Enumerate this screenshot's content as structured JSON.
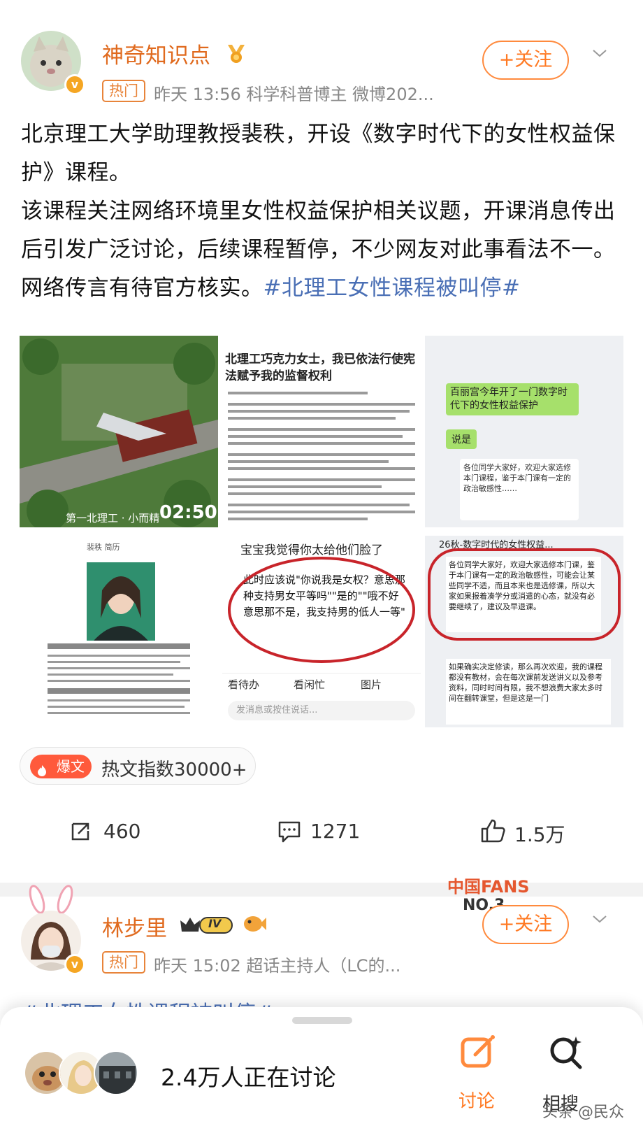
{
  "post1": {
    "username": "神奇知识点",
    "hot_tag": "热门",
    "meta": "昨天 13:56  科学科普博主 微博202...",
    "follow_label": "+关注",
    "paragraphs": [
      "北京理工大学助理教授裴秩，开设《数字时代下的女性权益保护》课程。",
      "该课程关注网络环境里女性权益保护相关议题，开课消息传出后引发广泛讨论，后续课程暂停，不少网友对此事看法不一。"
    ],
    "last_line_text": "网络传言有待官方核实。",
    "hashtag": "#北理工女性课程被叫停#",
    "images": {
      "video_caption": "第一北理工 · 小而精",
      "video_duration": "02:50",
      "doc_title": "北理工巧克力女士，我已依法行使宪法赋予我的监督权利",
      "chat_top_bubble1": "百丽宫今年开了一门数字时代下的女性权益保护",
      "chat_top_bubble2": "说是",
      "chat_top_msg": "各位同学大家好，欢迎大家选修本门课程，鉴于本门课有一定的政治敏感性……",
      "profile_name": "裴秩 简历",
      "chat_bottom_top": "宝宝我觉得你太给他们脸了",
      "chat_bottom_quote": "此时应该说\"你说我是女权？意思那种支持男女平等吗\"\"是的\"\"哦不好意思那不是，我支持男的低人一等\"",
      "chat_toolbar": [
        "看待办",
        "看闲忙",
        "图片"
      ],
      "chat_input_placeholder": "发消息或按住说话...",
      "group_title": "26秋-数字时代的女性权益...",
      "group_msg1": "各位同学大家好，欢迎大家选修本门课，鉴于本门课有一定的政治敏感性，可能会让某些同学不适，而且本来也是选修课，所以大家如果报着凑学分或消遣的心态，就没有必要继续了，建议及早退课。",
      "group_msg2": "如果确实决定修读，那么再次欢迎，我的课程都没有教材，会在每次课前发送讲义以及参考资料，同时时间有限，我不想浪费大家太多时间在翻转课堂，但是这是一门"
    },
    "hot_index_badge": "爆文",
    "hot_index_text": "热文指数30000+",
    "actions": {
      "repost": "460",
      "comments": "1271",
      "likes": "1.5万"
    }
  },
  "post2": {
    "username": "林步里",
    "level_badge": "IV",
    "hot_tag": "热门",
    "meta": "昨天 15:02  超话主持人（LC的...",
    "follow_label": "+关注",
    "fans_badge_title": "中国FANS",
    "fans_badge_no": "NO.3",
    "hashtag": "#北理工女性课程被叫停#"
  },
  "bottom_bar": {
    "discuss_count": "2.4万人正在讨论",
    "tab_discuss": "讨论",
    "tab_search": "相搜"
  },
  "watermark": "头条 @民众",
  "colors": {
    "accent_orange": "#ff7a24",
    "hashtag_blue": "#4a6fb5",
    "hot_red": "#ff5a3c"
  }
}
